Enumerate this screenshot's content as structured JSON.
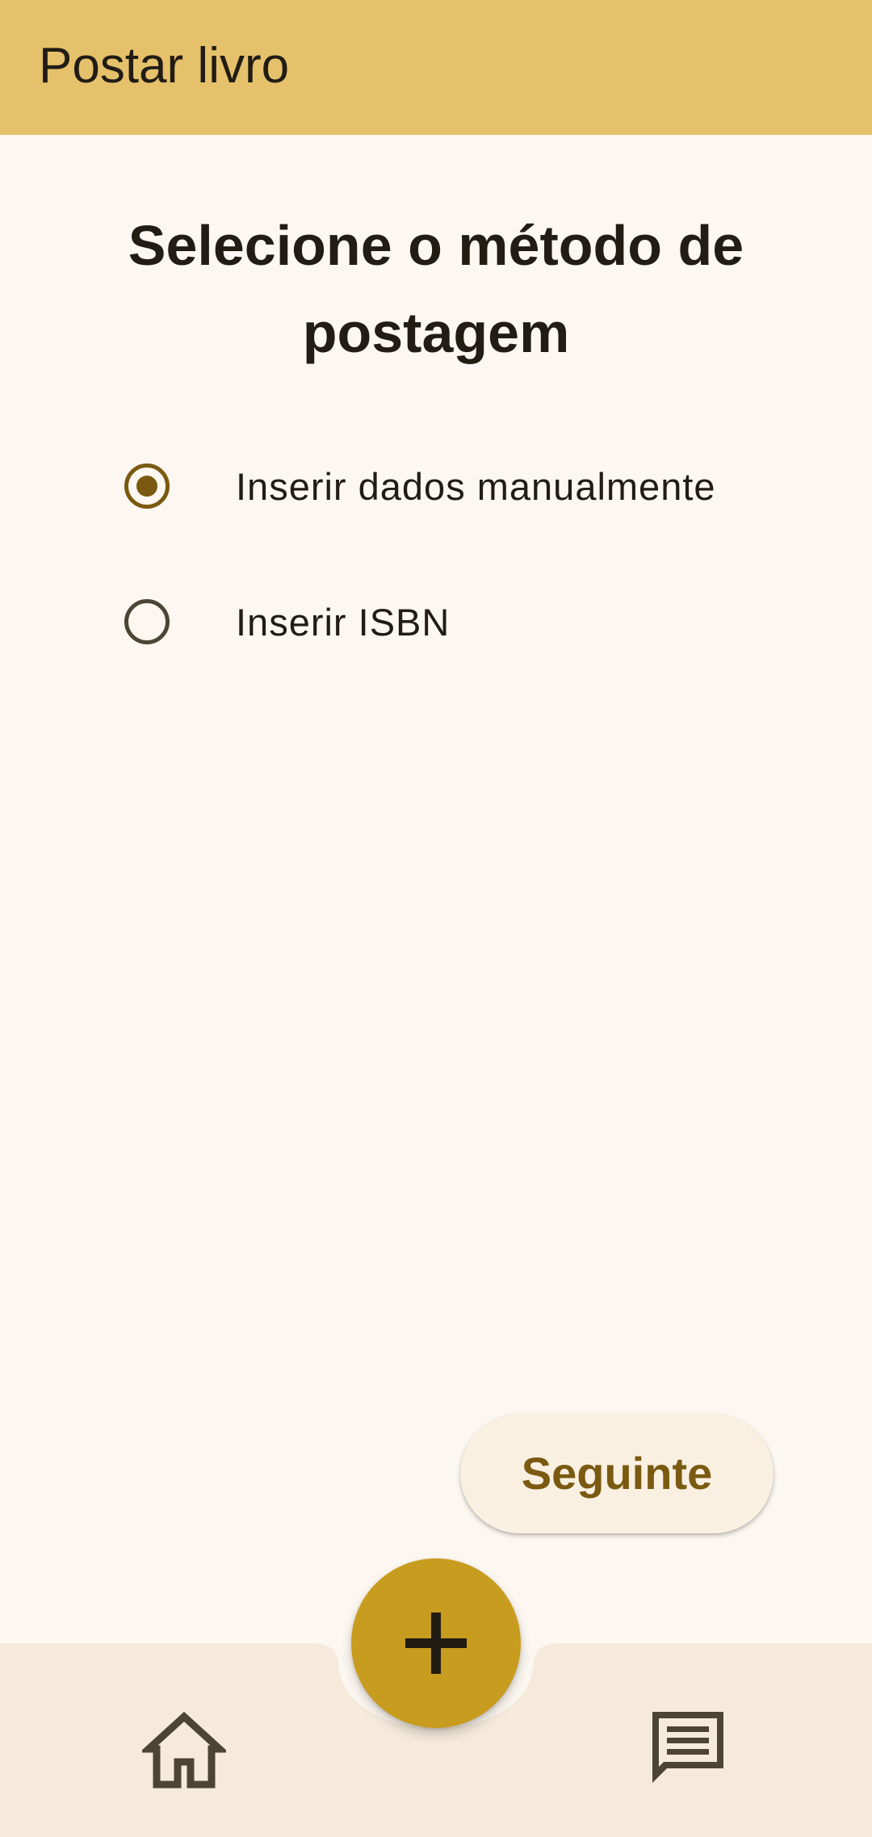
{
  "app_bar": {
    "title": "Postar livro"
  },
  "main": {
    "heading": "Selecione o método de postagem",
    "options": [
      {
        "label": "Inserir dados manualmente",
        "selected": true
      },
      {
        "label": "Inserir ISBN",
        "selected": false
      }
    ],
    "next_label": "Seguinte"
  },
  "bottom_nav": {
    "items": [
      {
        "icon": "home-icon"
      },
      {
        "icon": "add-icon"
      },
      {
        "icon": "chat-icon"
      }
    ]
  },
  "colors": {
    "app_bar": "#E5C16B",
    "background": "#FDF7F1",
    "bottom_bar": "#F5EADB",
    "accent": "#C89C1E",
    "primary_text": "#7A5A10",
    "on_surface": "#211C14"
  }
}
